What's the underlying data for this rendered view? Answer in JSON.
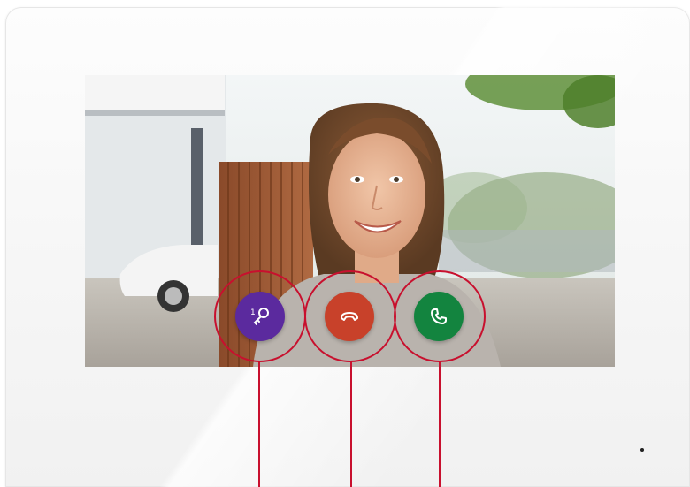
{
  "device": {
    "type": "video-door-intercom-monitor",
    "frame_color": "#f7f7f7"
  },
  "video_feed": {
    "content": "visitor-at-door"
  },
  "controls": {
    "unlock": {
      "label_number": "1",
      "icon": "key-icon",
      "color": "#5b2a9e"
    },
    "end_call": {
      "icon": "hang-up-icon",
      "color": "#c8412a"
    },
    "answer_call": {
      "icon": "phone-icon",
      "color": "#13843f"
    }
  },
  "callout_color": "#c8102e"
}
